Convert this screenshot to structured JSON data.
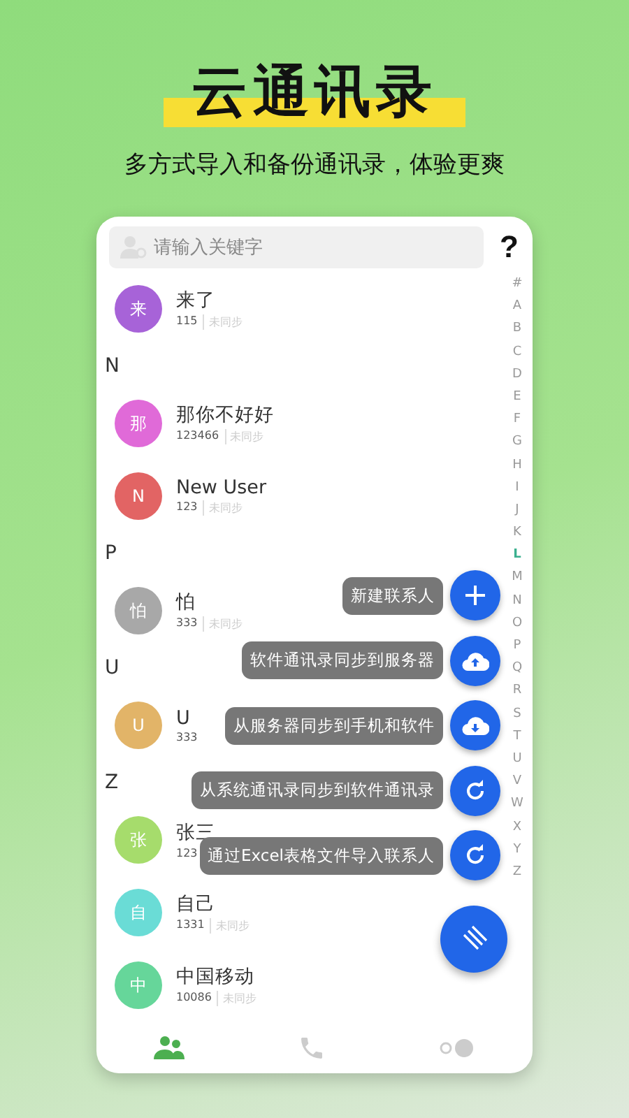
{
  "header": {
    "title": "云通讯录",
    "subtitle": "多方式导入和备份通讯录，体验更爽"
  },
  "search": {
    "placeholder": "请输入关键字",
    "help": "?"
  },
  "contacts": [
    {
      "kind": "contact",
      "avatar": "来",
      "color": "#a763d8",
      "name": "来了",
      "phone": "115",
      "status": "未同步"
    },
    {
      "kind": "header",
      "letter": "N"
    },
    {
      "kind": "contact",
      "avatar": "那",
      "color": "#e06ad8",
      "name": "那你不好好",
      "phone": "123466",
      "status": "未同步"
    },
    {
      "kind": "contact",
      "avatar": "N",
      "color": "#e26464",
      "name": "New User",
      "phone": "123",
      "status": "未同步"
    },
    {
      "kind": "header",
      "letter": "P"
    },
    {
      "kind": "contact",
      "avatar": "怕",
      "color": "#a8a8a8",
      "name": "怕",
      "phone": "333",
      "status": "未同步"
    },
    {
      "kind": "header",
      "letter": "U"
    },
    {
      "kind": "contact",
      "avatar": "U",
      "color": "#e2b468",
      "name": "U",
      "phone": "333"
    },
    {
      "kind": "header",
      "letter": "Z"
    },
    {
      "kind": "contact",
      "avatar": "张",
      "color": "#a6dc6c",
      "name": "张三",
      "phone": "123"
    },
    {
      "kind": "contact",
      "avatar": "自",
      "color": "#6adcd6",
      "name": "自己",
      "phone": "1331",
      "status": "未同步"
    },
    {
      "kind": "contact",
      "avatar": "中",
      "color": "#66d69a",
      "name": "中国移动",
      "phone": "10086",
      "status": "未同步"
    }
  ],
  "index": [
    {
      "letter": "#",
      "selected": false
    },
    {
      "letter": "A",
      "selected": false
    },
    {
      "letter": "B",
      "selected": false
    },
    {
      "letter": "C",
      "selected": false
    },
    {
      "letter": "D",
      "selected": false
    },
    {
      "letter": "E",
      "selected": false
    },
    {
      "letter": "F",
      "selected": false
    },
    {
      "letter": "G",
      "selected": false
    },
    {
      "letter": "H",
      "selected": false
    },
    {
      "letter": "I",
      "selected": false
    },
    {
      "letter": "J",
      "selected": false
    },
    {
      "letter": "K",
      "selected": false
    },
    {
      "letter": "L",
      "selected": true
    },
    {
      "letter": "M",
      "selected": false
    },
    {
      "letter": "N",
      "selected": false
    },
    {
      "letter": "O",
      "selected": false
    },
    {
      "letter": "P",
      "selected": false
    },
    {
      "letter": "Q",
      "selected": false
    },
    {
      "letter": "R",
      "selected": false
    },
    {
      "letter": "S",
      "selected": false
    },
    {
      "letter": "T",
      "selected": false
    },
    {
      "letter": "U",
      "selected": false
    },
    {
      "letter": "V",
      "selected": false
    },
    {
      "letter": "W",
      "selected": false
    },
    {
      "letter": "X",
      "selected": false
    },
    {
      "letter": "Y",
      "selected": false
    },
    {
      "letter": "Z",
      "selected": false
    }
  ],
  "actions": [
    {
      "kind": "add",
      "label": "新建联系人"
    },
    {
      "kind": "upload",
      "label": "软件通讯录同步到服务器"
    },
    {
      "kind": "download",
      "label": "从服务器同步到手机和软件"
    },
    {
      "kind": "refresh",
      "label": "从系统通讯录同步到软件通讯录"
    },
    {
      "kind": "refresh",
      "label": "通过Excel表格文件导入联系人"
    }
  ],
  "nav": [
    {
      "kind": "contacts",
      "selected": true
    },
    {
      "kind": "phone",
      "selected": false
    },
    {
      "kind": "toggle",
      "selected": false
    }
  ]
}
